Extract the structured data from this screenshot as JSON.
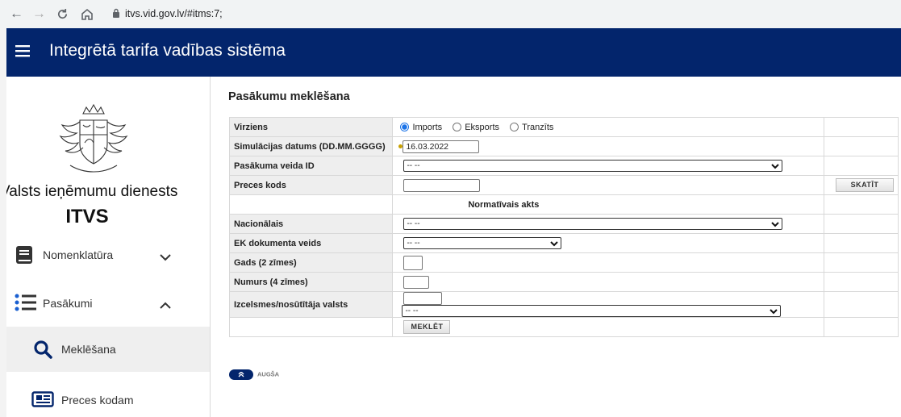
{
  "browser": {
    "url": "itvs.vid.gov.lv/#itms:7;"
  },
  "header": {
    "title": "Integrētā tarifa vadības sistēma"
  },
  "sidebar": {
    "org_name": "Valsts ieņēmumu dienests",
    "app_short": "ITVS",
    "items": [
      {
        "label": "Nomenklatūra",
        "icon": "book-icon",
        "expanded": false
      },
      {
        "label": "Pasākumi",
        "icon": "list-icon",
        "expanded": true
      },
      {
        "label": "Meklēšana",
        "icon": "search-icon",
        "active": true
      },
      {
        "label": "Preces kodam",
        "icon": "newspaper-icon"
      }
    ]
  },
  "main": {
    "page_title": "Pasākumu meklēšana",
    "form": {
      "direction": {
        "label": "Virziens",
        "options": [
          "Imports",
          "Eksports",
          "Tranzīts"
        ],
        "selected": "Imports"
      },
      "sim_date": {
        "label": "Simulācijas datums (DD.MM.GGGG)",
        "value": "16.03.2022"
      },
      "measure_type": {
        "label": "Pasākuma veida ID",
        "value": "-- --"
      },
      "goods_code": {
        "label": "Preces kods",
        "value": "",
        "button": "SKATĪT"
      },
      "section_title": "Normatīvais akts",
      "national": {
        "label": "Nacionālais",
        "value": "-- --"
      },
      "ec_doc": {
        "label": "EK dokumenta veids",
        "value": "-- --"
      },
      "year": {
        "label": "Gads (2 zīmes)",
        "value": ""
      },
      "number": {
        "label": "Numurs (4 zīmes)",
        "value": ""
      },
      "origin": {
        "label": "Izcelsmes/nosūtītāja valsts",
        "code": "",
        "value": "-- --"
      },
      "search_button": "MEKLĒT"
    },
    "up_label": "AUGŠA"
  },
  "colors": {
    "header_bg": "#03256c",
    "label_bg": "#eeeeee",
    "radio_accent": "#1a73e8"
  }
}
